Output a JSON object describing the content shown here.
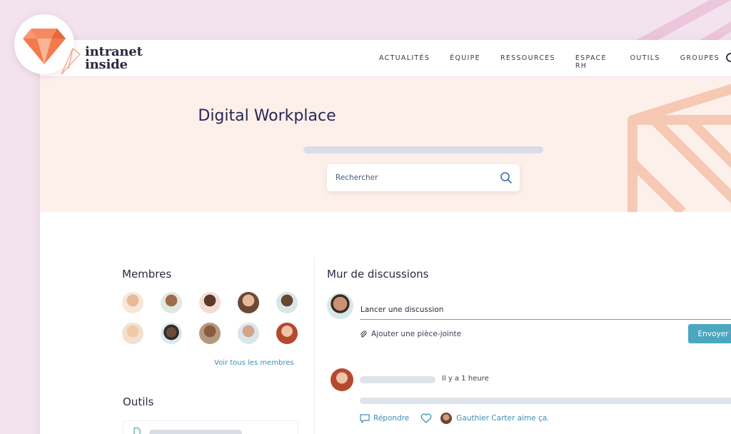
{
  "brand": {
    "line1": "intranet",
    "line2": "inside"
  },
  "nav": {
    "items": [
      "ACTUALITÉS",
      "ÉQUIPE",
      "RESSOURCES",
      "ESPACE RH",
      "OUTILS",
      "GROUPES"
    ],
    "search_icon": "search-icon"
  },
  "hero": {
    "title": "Digital Workplace",
    "search_placeholder": "Rechercher"
  },
  "members": {
    "title": "Membres",
    "see_all": "Voir tous les membres",
    "count_visible": 10
  },
  "tools": {
    "title": "Outils"
  },
  "wall": {
    "title": "Mur de discussions",
    "compose_label": "Lancer une discussion",
    "attach_label": "Ajouter une pièce-jointe",
    "send_label": "Envoyer",
    "post": {
      "time": "Il y a 1 heure",
      "reply_label": "Répondre",
      "like_text": "Gauthier Carter aime ça."
    }
  },
  "colors": {
    "accent": "#4aa7bf",
    "brand_orange": "#f47a4d",
    "hero_bg": "#fdf0ea",
    "page_bg": "#f3e3ee"
  }
}
